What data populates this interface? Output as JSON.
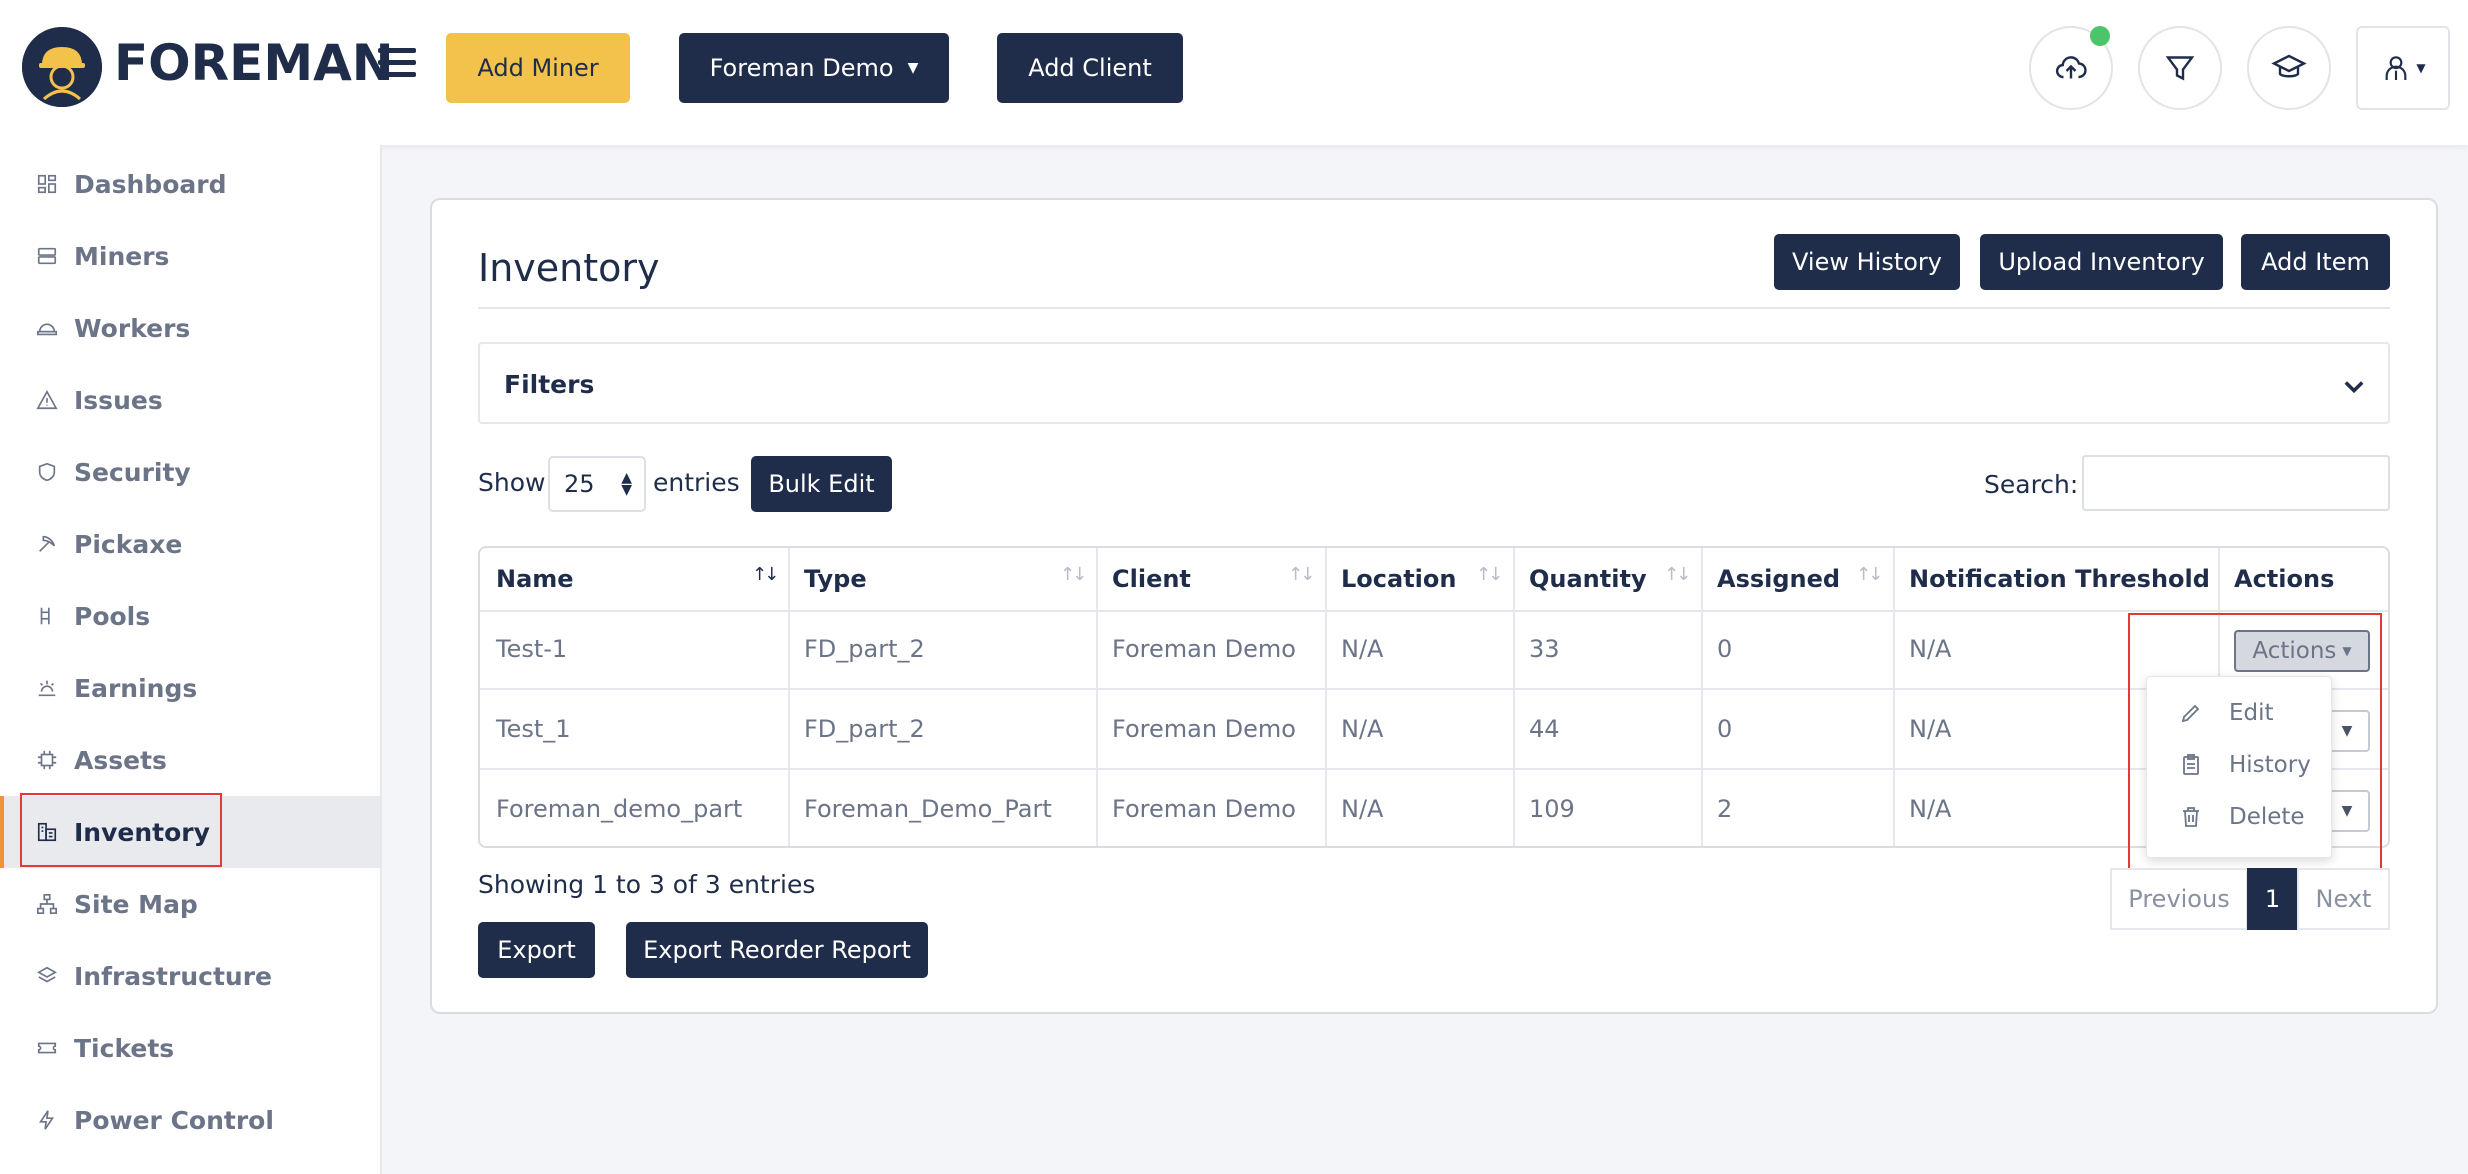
{
  "header": {
    "brand": "FOREMAN",
    "add_miner_label": "Add Miner",
    "client_select_label": "Foreman Demo",
    "add_client_label": "Add Client"
  },
  "sidebar": {
    "items": [
      {
        "label": "Dashboard",
        "icon": "dashboard-icon"
      },
      {
        "label": "Miners",
        "icon": "server-icon"
      },
      {
        "label": "Workers",
        "icon": "hardhat-icon"
      },
      {
        "label": "Issues",
        "icon": "warning-icon"
      },
      {
        "label": "Security",
        "icon": "shield-icon"
      },
      {
        "label": "Pickaxe",
        "icon": "pickaxe-icon"
      },
      {
        "label": "Pools",
        "icon": "pools-icon"
      },
      {
        "label": "Earnings",
        "icon": "earnings-icon"
      },
      {
        "label": "Assets",
        "icon": "chip-icon"
      },
      {
        "label": "Inventory",
        "icon": "inventory-icon"
      },
      {
        "label": "Site Map",
        "icon": "sitemap-icon"
      },
      {
        "label": "Infrastructure",
        "icon": "layers-icon"
      },
      {
        "label": "Tickets",
        "icon": "ticket-icon"
      },
      {
        "label": "Power Control",
        "icon": "bolt-icon"
      }
    ]
  },
  "main": {
    "title": "Inventory",
    "view_history_label": "View History",
    "upload_inventory_label": "Upload Inventory",
    "add_item_label": "Add Item",
    "filters_label": "Filters",
    "show_label": "Show",
    "entries_value": "25",
    "entries_label": "entries",
    "bulk_edit_label": "Bulk Edit",
    "search_label": "Search:",
    "search_value": "",
    "info": "Showing 1 to 3 of 3 entries",
    "export_label": "Export",
    "export_reorder_label": "Export Reorder Report",
    "pagination": {
      "previous": "Previous",
      "current": "1",
      "next": "Next"
    }
  },
  "table": {
    "headers": [
      "Name",
      "Type",
      "Client",
      "Location",
      "Quantity",
      "Assigned",
      "Notification Threshold",
      "Actions"
    ],
    "rows": [
      [
        "Test-1",
        "FD_part_2",
        "Foreman Demo",
        "N/A",
        "33",
        "0",
        "N/A"
      ],
      [
        "Test_1",
        "FD_part_2",
        "Foreman Demo",
        "N/A",
        "44",
        "0",
        "N/A"
      ],
      [
        "Foreman_demo_part",
        "Foreman_Demo_Part",
        "Foreman Demo",
        "N/A",
        "109",
        "2",
        "N/A"
      ]
    ],
    "actions_label": "Actions"
  },
  "dropdown": {
    "items": [
      "Edit",
      "History",
      "Delete"
    ]
  },
  "colors": {
    "navy": "#1f2d4a",
    "yellow": "#f3c24b",
    "status_green": "#4cc46a",
    "highlight_red": "#e53935",
    "sidebar_accent": "#f0923a"
  }
}
